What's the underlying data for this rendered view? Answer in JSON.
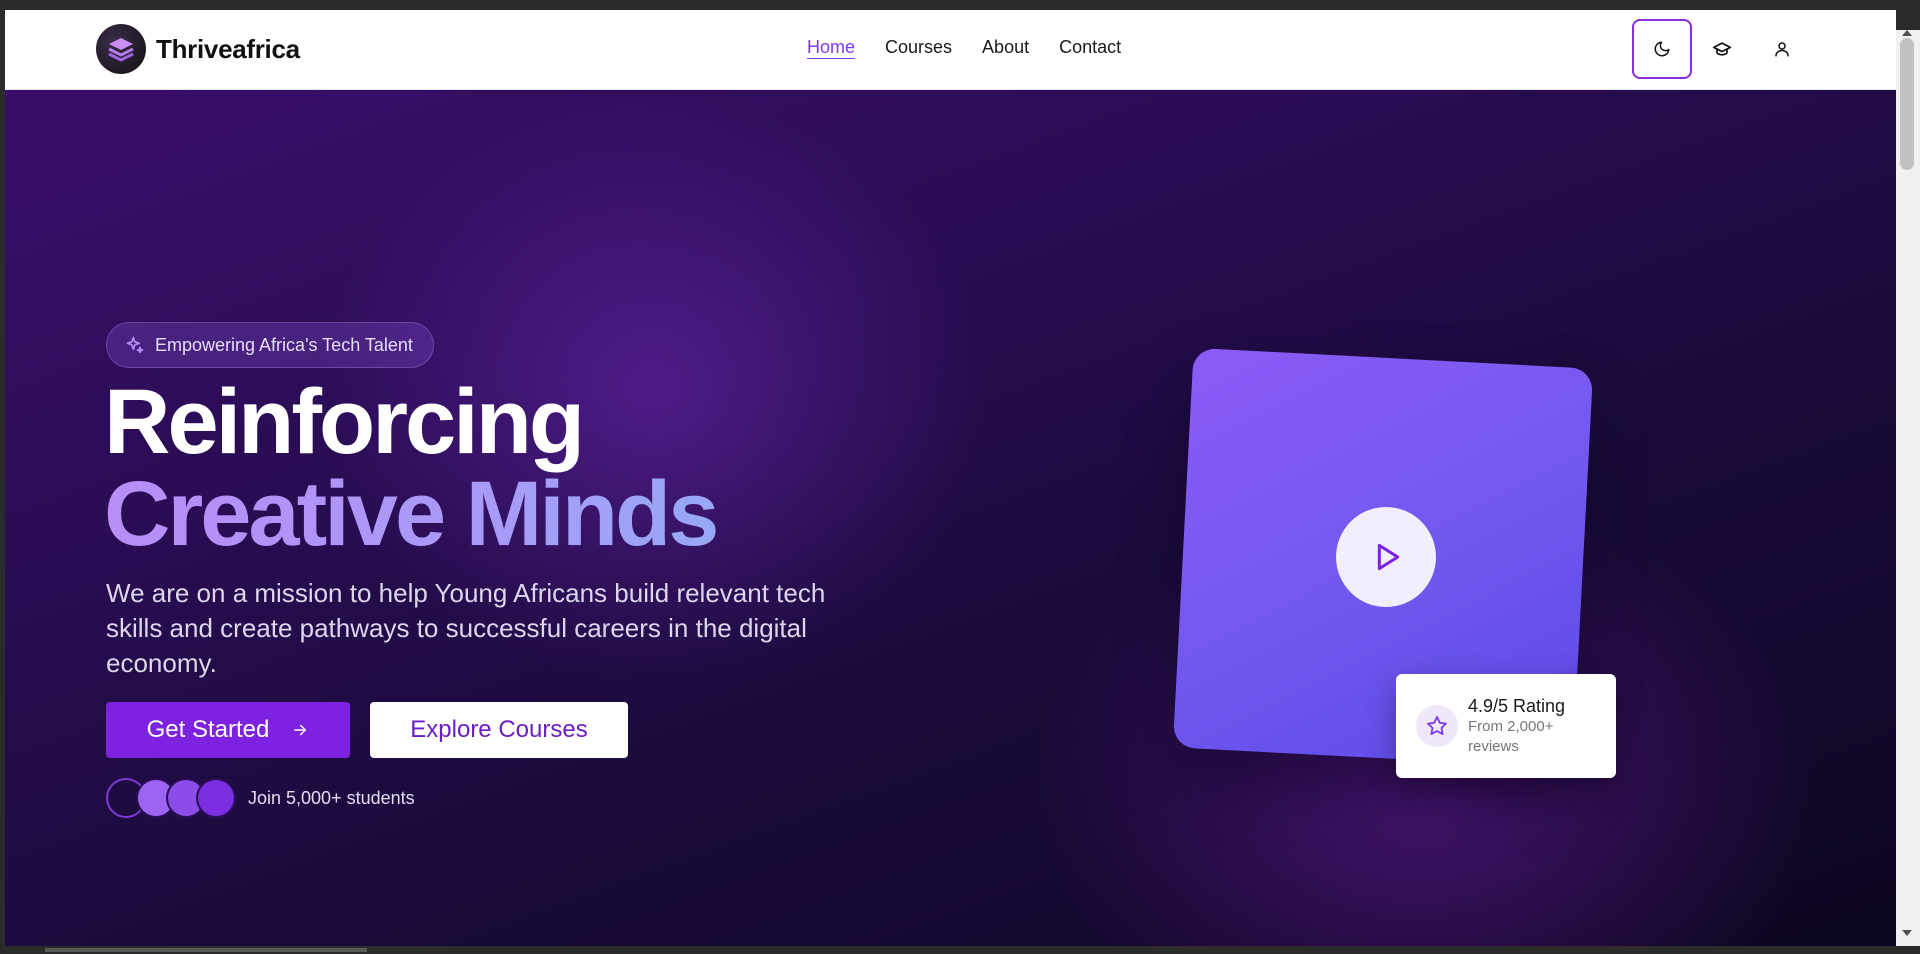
{
  "nav": {
    "brand": "Thriveafrica",
    "links": [
      {
        "label": "Home",
        "active": true
      },
      {
        "label": "Courses",
        "active": false
      },
      {
        "label": "About",
        "active": false
      },
      {
        "label": "Contact",
        "active": false
      }
    ],
    "actions": [
      "moon-icon",
      "graduation-cap-icon",
      "user-icon"
    ]
  },
  "hero": {
    "badge": "Empowering Africa's Tech Talent",
    "headline_line1": "Reinforcing",
    "headline_line2": "Creative Minds",
    "subtitle": "We are on a mission to help Young Africans build relevant tech skills and create pathways to successful careers in the digital economy.",
    "primary_cta": "Get Started",
    "secondary_cta": "Explore Courses",
    "social_proof": "Join 5,000+ students"
  },
  "rating": {
    "title": "4.9/5 Rating",
    "subtitle": "From 2,000+ reviews"
  },
  "colors": {
    "accent": "#7c22e0",
    "link_active": "#7c3aed",
    "hero_dark": "#14082e"
  }
}
